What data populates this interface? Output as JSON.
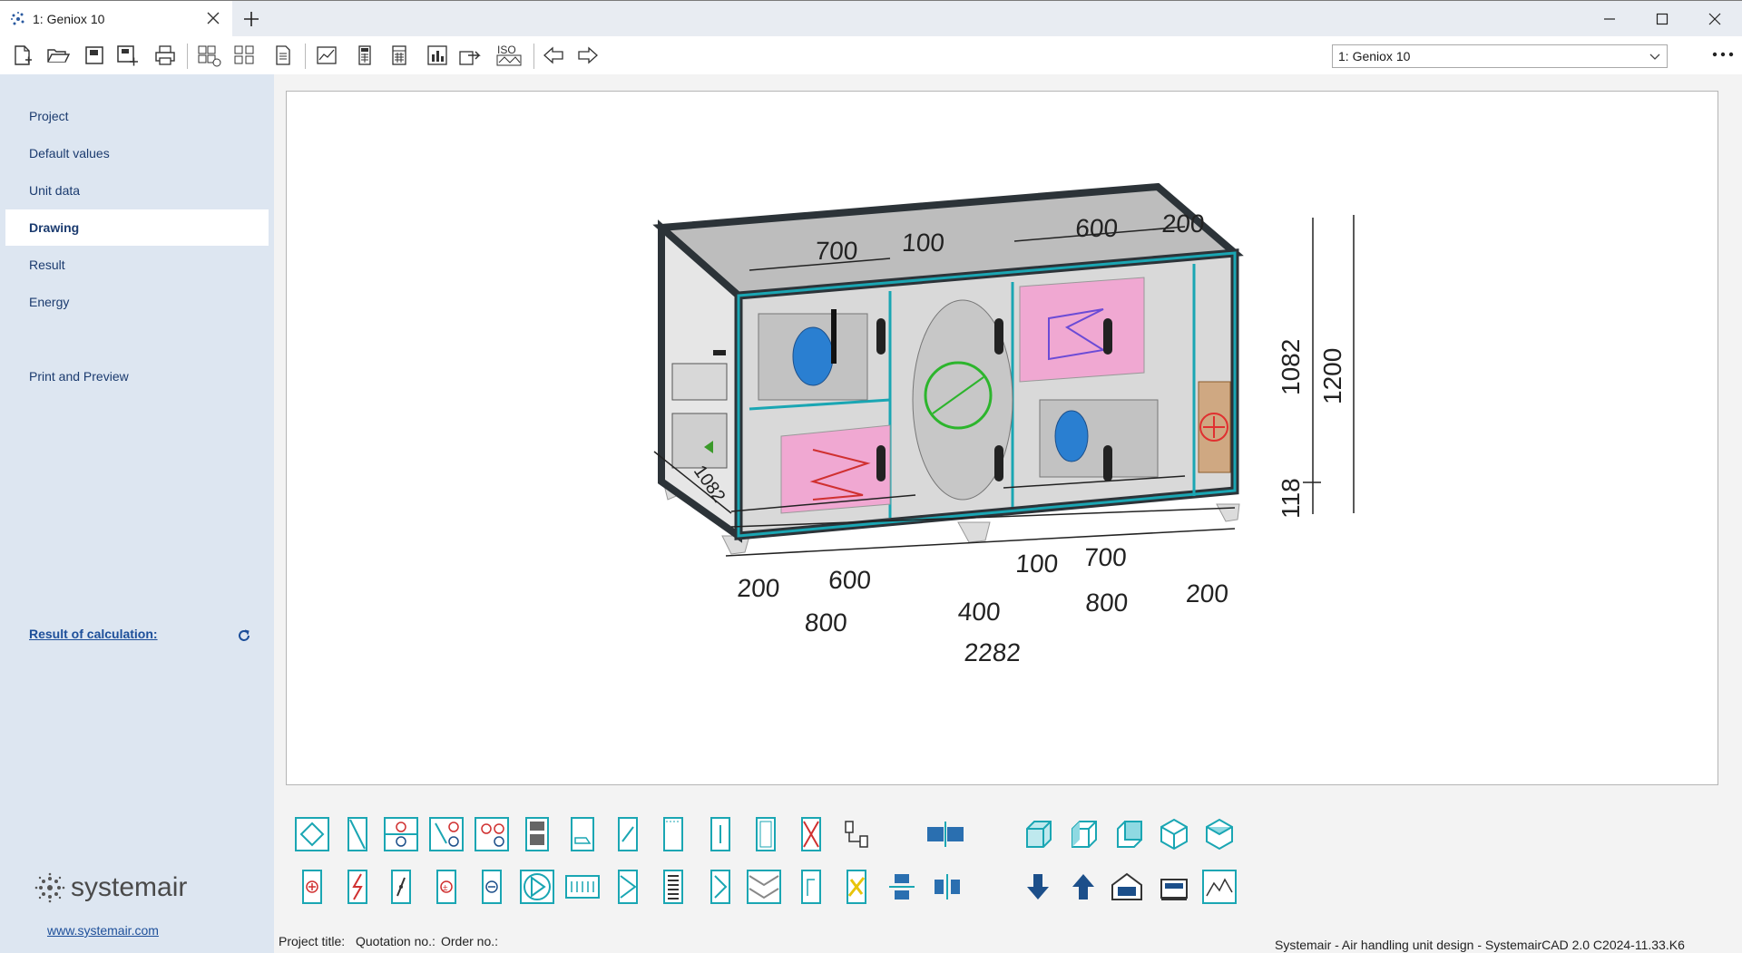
{
  "window": {
    "tab_title": "1: Geniox 10",
    "new_tab_symbol": "+",
    "controls": [
      "minimize-icon",
      "maximize-icon",
      "close-icon"
    ]
  },
  "toolbar": {
    "icons": [
      "new-file-icon",
      "open-folder-icon",
      "save-icon",
      "save-as-icon",
      "print-icon",
      "add-component-grid-icon",
      "component-grid-icon",
      "document-icon",
      "chart-icon",
      "calculator-icon",
      "calculator-table-icon",
      "report-chart-icon",
      "export-icon",
      "iso-icon",
      "back-arrow-icon",
      "forward-arrow-icon"
    ],
    "unit_selector_value": "1: Geniox 10"
  },
  "sidebar": {
    "items": [
      {
        "label": "Project"
      },
      {
        "label": "Default values"
      },
      {
        "label": "Unit data"
      },
      {
        "label": "Drawing",
        "active": true
      },
      {
        "label": "Result"
      },
      {
        "label": "Energy"
      },
      {
        "label": "Print and Preview"
      }
    ],
    "result_link": "Result of calculation:",
    "logo_text": "systemair",
    "website": "www.systemair.com"
  },
  "drawing": {
    "dimensions": {
      "top": [
        "700",
        "100",
        "600",
        "200"
      ],
      "right": [
        "1082",
        "1200",
        "118"
      ],
      "depth": "1082",
      "bottom_row1": [
        "200",
        "600",
        "100",
        "700"
      ],
      "bottom_row2": [
        "800",
        "400",
        "800",
        "200"
      ],
      "total": "2282"
    }
  },
  "component_palette": {
    "row1": [
      "section-icon",
      "damper-icon",
      "fan-section-icon",
      "filter-fan-icon",
      "double-fan-icon",
      "control-panel-icon",
      "sensor-icon",
      "bag-filter-icon",
      "panel-filter-icon",
      "empty-section-icon",
      "blank-section-icon",
      "crossed-section-icon",
      "connector-icon",
      "split-view-icon",
      "cube-front-icon",
      "cube-left-icon",
      "cube-back-icon",
      "cube-iso-icon",
      "cube-rotate-icon"
    ],
    "row2": [
      "heater-icon",
      "electric-heater-icon",
      "damper-actuator-icon",
      "heating-coil-icon",
      "cooling-coil-icon",
      "fan-icon",
      "silencer-icon",
      "heat-recovery-icon",
      "plate-filter-icon",
      "v-filter-icon",
      "chevron-filter-icon",
      "humidifier-icon",
      "rotary-icon",
      "align-vertical-icon",
      "align-horizontal-icon",
      "arrow-down-icon",
      "arrow-up-icon",
      "building-icon",
      "unit-icon",
      "diagram-icon"
    ]
  },
  "status_bar": {
    "project_title": "Project title:",
    "quotation": "Quotation no.:",
    "order": "Order no.:",
    "app_info": "Systemair - Air handling unit design - SystemairCAD 2.0 C2024-11.33.K6"
  },
  "colors": {
    "sidebar_bg": "#dde6f1",
    "accent_teal": "#1aa6b3",
    "link_blue": "#1d4f9a"
  }
}
